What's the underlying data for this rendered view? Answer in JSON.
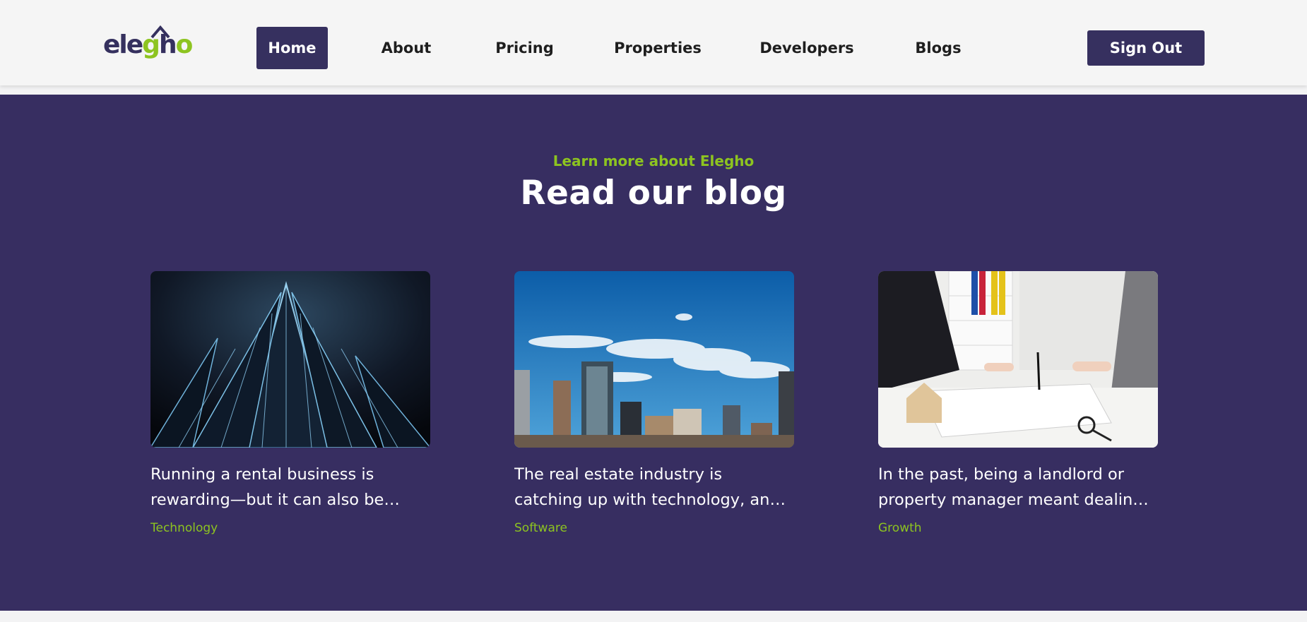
{
  "nav": {
    "logo_text": "elegho",
    "items": [
      "Home",
      "About",
      "Pricing",
      "Properties",
      "Developers",
      "Blogs"
    ],
    "active": "Home",
    "signout_label": "Sign Out"
  },
  "blog": {
    "eyebrow": "Learn more about Elegho",
    "heading": "Read our blog",
    "cards": [
      {
        "title": "Running a rental business is rewarding—but it can also be overwhelming",
        "tag": "Technology",
        "image": "illuminated-skyscraper-night-image"
      },
      {
        "title": "The real estate industry is catching up with technology, and more",
        "tag": "Software",
        "image": "city-skyline-blue-sky-image"
      },
      {
        "title": "In the past, being a landlord or property manager meant dealing with paperwork",
        "tag": "Growth",
        "image": "signing-property-contract-image"
      }
    ]
  },
  "colors": {
    "brand_purple": "#36305f",
    "hero_bg": "#372e61",
    "accent_green": "#8dc420",
    "nav_bg": "#f5f5f5"
  }
}
